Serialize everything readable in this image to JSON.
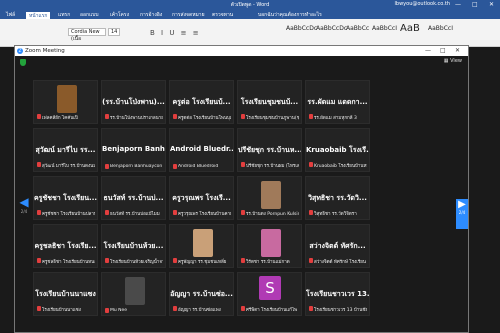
{
  "word": {
    "title": "ตัวเปิดพูด - Word",
    "account": "lbwyou@outlook.co.th",
    "tabs": [
      {
        "label": "ไฟล์",
        "active": false
      },
      {
        "label": "หน้าแรก",
        "active": true
      },
      {
        "label": "แทรก",
        "active": false
      },
      {
        "label": "ออกแบบ",
        "active": false
      },
      {
        "label": "เค้าโครง",
        "active": false
      },
      {
        "label": "การอ้างอิง",
        "active": false
      },
      {
        "label": "การส่งจดหมาย",
        "active": false
      },
      {
        "label": "ตรวจทาน",
        "active": false
      },
      {
        "label": "มุมมอง",
        "active": false
      },
      {
        "label": "วิธีใช้",
        "active": false
      }
    ],
    "tell_me": "บอกฉันว่าคุณต้องการทำอะไร",
    "font_name": "Cordia New (เนื้อ",
    "font_size": "14",
    "styles": [
      "AaBbCcDc",
      "AaBbCcDc",
      "AaBbCc",
      "AaBbCcI",
      "AaB",
      "AaBbCcI"
    ]
  },
  "zoom": {
    "title": "Zoom Meeting",
    "view_label": "View",
    "page_indicator": "2/4",
    "tiles": [
      {
        "big": "",
        "label": "เฟลคลีย์ก ไคคันเปิ",
        "photo": "#8a5a2a"
      },
      {
        "big": "(รร.บ้านโป่งพาน)...",
        "label": "รร.บ้านโป่งพานปราเกลนายม"
      },
      {
        "big": "ครูต่อ โรงเรียนบ้...",
        "label": "ครูตต่อ โรงเรียนบ้านโพนบุญ"
      },
      {
        "big": "โรงเรียนชุมชนบ้...",
        "label": "โรงเรียนชุมชนบ้านภูพาน(ชุมชนบ้าน)"
      },
      {
        "big": "รร.ผัดแม แดดกา...",
        "label": "รร.ผัดแม สามหุกกลี 3"
      },
      {
        "big": "สุวัฒน์ มารีไบ รร...",
        "label": "สุวัฒน์ มารีไบ รร.บ้านดงนมก"
      },
      {
        "big": "Benjaporn Banh...",
        "label": "Benjaporn Banhuaycon"
      },
      {
        "big": "Android Bluedr...",
        "label": "Android Bluedroid"
      },
      {
        "big": "ปรีชัยชุก รร.บ้านห...",
        "label": "ปรีชัยชุก รร.บ้านผม (ไหรเล)"
      },
      {
        "big": "Kruaobaib โรงเรี...",
        "label": "Kruaobaib โรงเรียนบ้านหนอง"
      },
      {
        "big": "ครูชัชชา โรงเรียน...",
        "label": "ครูชัชชา โรงเรียนบ้านปลาหัวแท่"
      },
      {
        "big": "ธนวัสท์ รร.บ้านบ่...",
        "label": "ธนวัสท์ รร.บ้านบ่อแบ้ไมม"
      },
      {
        "big": "ครูวรุณพร โรงเรี...",
        "label": "ครูวรุณพร โรงเรียนบ้านคายาด้วยส"
      },
      {
        "big": "",
        "label": "รร.บ้านดง Pornpun Kulsiri",
        "photo": "#a07a5a"
      },
      {
        "big": "วิสุทธิชา รร.วัดวิ...",
        "label": "วิสุทธิชา รร.วัดวิจิตรา"
      },
      {
        "big": "ครูชลธิชา โรงเรีย...",
        "label": "ครูชลธิชา โรงเรียนบ้านหนองห"
      },
      {
        "big": "โรงเรียนบ้านห้วย...",
        "label": "โรงเรียนบ้านห้วยเจริญน้ำจา"
      },
      {
        "big": "",
        "label": "ครูพัญญา รร.ชุมชนเหลี่ย",
        "photo": "#c9a078"
      },
      {
        "big": "",
        "label": "วิรัตชา รร.บ้านแม่กาด",
        "photo": "#c86aa0"
      },
      {
        "big": "สว่างจิตต์ ทัศรัก...",
        "label": "สว่างจิตต์ ทัศรักษ์ โรงเรียน"
      },
      {
        "big": "โรงเรียนบ้านนาแซง",
        "label": "โรงเรียนบ้านนาแซง"
      },
      {
        "big": "",
        "label": "Mu Nee",
        "photo": "#4a4a4a"
      },
      {
        "big": "อัญญา รร.บ้านซ่อ...",
        "label": "อัญญา รร.บ้านซ่อแพง"
      },
      {
        "big": "",
        "label": "ศรีพิดา โรงเรียนบ้านแก้ไพ",
        "avatar": "S"
      },
      {
        "big": "โรงเรียนชาวเวร 13...",
        "label": "โรงเรียนชาวเวร 13 บ้านชัยประชา"
      }
    ]
  }
}
